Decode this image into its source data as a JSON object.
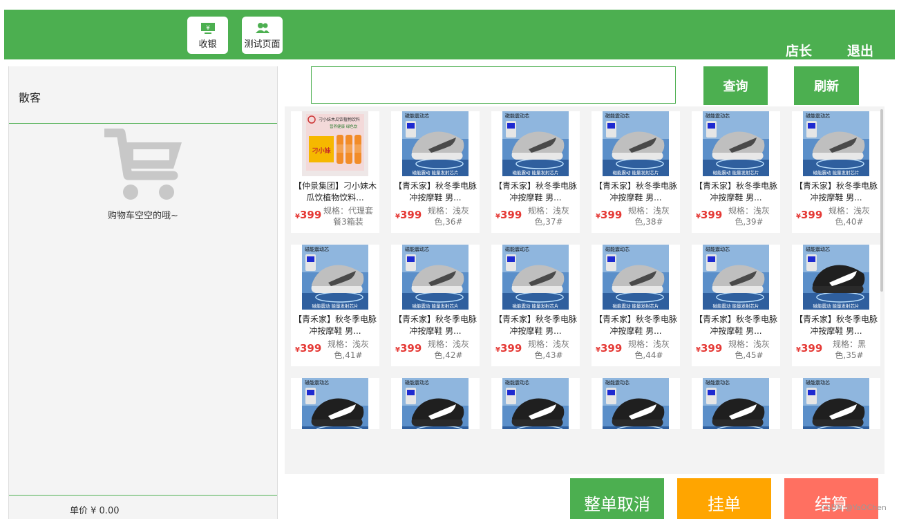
{
  "header": {
    "nav": [
      {
        "label": "收银",
        "icon": "cashier-icon"
      },
      {
        "label": "测试页面",
        "icon": "users-icon"
      }
    ],
    "user_label": "店长",
    "logout_label": "退出"
  },
  "cart": {
    "customer": "散客",
    "empty_text": "购物车空空的哦~",
    "unit_price": "单价 ¥ 0.00",
    "icon": "cart-icon"
  },
  "search": {
    "value": "",
    "query_label": "查询",
    "refresh_label": "刷新"
  },
  "products": [
    {
      "name": "【仲景集团】刁小妹木瓜饮植物饮料...",
      "price": "399",
      "currency": "¥",
      "spec": "规格：代理套餐3箱装",
      "img": "drink"
    },
    {
      "name": "【青禾家】秋冬季电脉冲按摩鞋 男...",
      "price": "399",
      "currency": "¥",
      "spec": "规格：浅灰色,36#",
      "img": "gray-shoe"
    },
    {
      "name": "【青禾家】秋冬季电脉冲按摩鞋 男...",
      "price": "399",
      "currency": "¥",
      "spec": "规格：浅灰色,37#",
      "img": "gray-shoe"
    },
    {
      "name": "【青禾家】秋冬季电脉冲按摩鞋 男...",
      "price": "399",
      "currency": "¥",
      "spec": "规格：浅灰色,38#",
      "img": "gray-shoe"
    },
    {
      "name": "【青禾家】秋冬季电脉冲按摩鞋 男...",
      "price": "399",
      "currency": "¥",
      "spec": "规格：浅灰色,39#",
      "img": "gray-shoe"
    },
    {
      "name": "【青禾家】秋冬季电脉冲按摩鞋 男...",
      "price": "399",
      "currency": "¥",
      "spec": "规格：浅灰色,40#",
      "img": "gray-shoe"
    },
    {
      "name": "【青禾家】秋冬季电脉冲按摩鞋 男...",
      "price": "399",
      "currency": "¥",
      "spec": "规格：浅灰色,41#",
      "img": "gray-shoe"
    },
    {
      "name": "【青禾家】秋冬季电脉冲按摩鞋 男...",
      "price": "399",
      "currency": "¥",
      "spec": "规格：浅灰色,42#",
      "img": "gray-shoe"
    },
    {
      "name": "【青禾家】秋冬季电脉冲按摩鞋 男...",
      "price": "399",
      "currency": "¥",
      "spec": "规格：浅灰色,43#",
      "img": "gray-shoe"
    },
    {
      "name": "【青禾家】秋冬季电脉冲按摩鞋 男...",
      "price": "399",
      "currency": "¥",
      "spec": "规格：浅灰色,44#",
      "img": "gray-shoe"
    },
    {
      "name": "【青禾家】秋冬季电脉冲按摩鞋 男...",
      "price": "399",
      "currency": "¥",
      "spec": "规格：浅灰色,45#",
      "img": "gray-shoe"
    },
    {
      "name": "【青禾家】秋冬季电脉冲按摩鞋 男...",
      "price": "399",
      "currency": "¥",
      "spec": "规格：黑色,35#",
      "img": "black-shoe"
    },
    {
      "name": "",
      "price": "",
      "currency": "",
      "spec": "",
      "img": "black-shoe"
    },
    {
      "name": "",
      "price": "",
      "currency": "",
      "spec": "",
      "img": "black-shoe"
    },
    {
      "name": "",
      "price": "",
      "currency": "",
      "spec": "",
      "img": "black-shoe"
    },
    {
      "name": "",
      "price": "",
      "currency": "",
      "spec": "",
      "img": "black-shoe"
    },
    {
      "name": "",
      "price": "",
      "currency": "",
      "spec": "",
      "img": "black-shoe"
    },
    {
      "name": "",
      "price": "",
      "currency": "",
      "spec": "",
      "img": "black-shoe"
    }
  ],
  "product_image_text": {
    "shoe_top": "磁能震动芯",
    "shoe_bottom": "磁能震动 能量发射芯片",
    "drink_top": "刁小妹木瓜饮植物饮料",
    "drink_sub": "营养健康 绿色饮",
    "drink_box": "刁小妹"
  },
  "footer": {
    "cancel_label": "整单取消",
    "hold_label": "挂单",
    "checkout_label": "结算"
  },
  "colors": {
    "primary": "#4caf50",
    "hold": "#ffa500",
    "checkout": "#ff7061",
    "price": "#e53935"
  },
  "watermark": "CSDN @YaOChen"
}
